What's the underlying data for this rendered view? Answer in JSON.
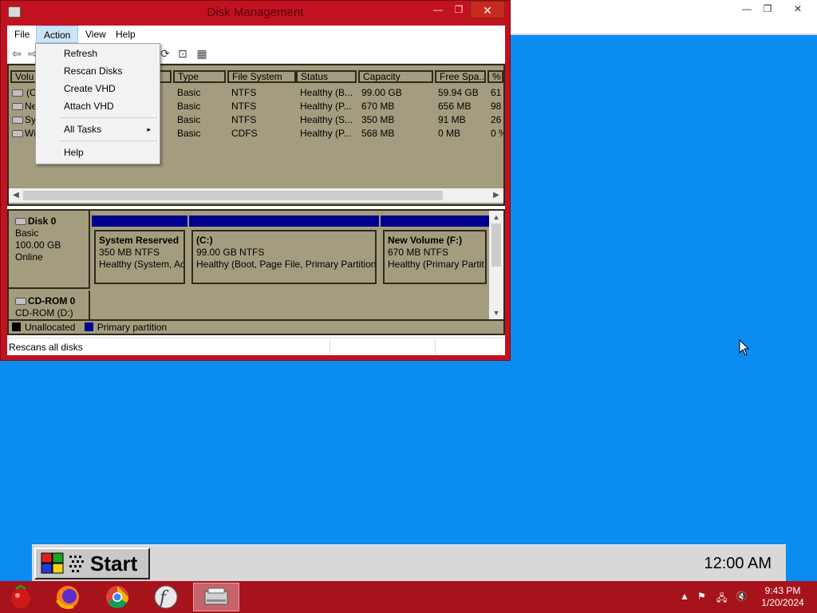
{
  "window": {
    "title": "Disk Management",
    "close_glyph": "✕",
    "min_glyph": "—",
    "max_glyph": "❐"
  },
  "menubar": [
    "File",
    "Action",
    "View",
    "Help"
  ],
  "action_menu": {
    "items": [
      "Refresh",
      "Rescan Disks",
      "Create VHD",
      "Attach VHD",
      "All Tasks",
      "Help"
    ],
    "submenu_arrow": "▸"
  },
  "volume_table": {
    "headers": [
      "Volu",
      "Type",
      "File System",
      "Status",
      "Capacity",
      "Free Spa...",
      "% F"
    ],
    "rows": [
      {
        "name": "(C",
        "type": "Basic",
        "fs": "NTFS",
        "status": "Healthy (B...",
        "capacity": "99.00 GB",
        "free": "59.94 GB",
        "pct": "61"
      },
      {
        "name": "Ne",
        "type": "Basic",
        "fs": "NTFS",
        "status": "Healthy (P...",
        "capacity": "670 MB",
        "free": "656 MB",
        "pct": "98"
      },
      {
        "name": "Sys",
        "type": "Basic",
        "fs": "NTFS",
        "status": "Healthy (S...",
        "capacity": "350 MB",
        "free": "91 MB",
        "pct": "26"
      },
      {
        "name": "Wi",
        "type": "Basic",
        "fs": "CDFS",
        "status": "Healthy (P...",
        "capacity": "568 MB",
        "free": "0 MB",
        "pct": "0 %"
      }
    ]
  },
  "disks": [
    {
      "name": "Disk 0",
      "kind": "Basic",
      "size": "100.00 GB",
      "state": "Online",
      "partitions": [
        {
          "name": "System Reserved",
          "detail": "350 MB NTFS",
          "status": "Healthy (System, Ac"
        },
        {
          "name": "(C:)",
          "detail": "99.00 GB NTFS",
          "status": "Healthy (Boot, Page File, Primary Partition)"
        },
        {
          "name": "New Volume  (F:)",
          "detail": "670 MB NTFS",
          "status": "Healthy (Primary Partit"
        }
      ]
    },
    {
      "name": "CD-ROM 0",
      "kind": "CD-ROM (D:)"
    }
  ],
  "legend": {
    "unallocated": "Unallocated",
    "primary": "Primary partition",
    "colors": {
      "unallocated": "#000000",
      "primary": "#000090"
    }
  },
  "status_text": "Rescans all disks",
  "startbar": {
    "start_label": "Start",
    "clock": "12:00 AM"
  },
  "taskbar": {
    "apps": [
      "tomato-app-icon",
      "firefox-icon",
      "chrome-icon",
      "flash-icon",
      "disk-management-icon"
    ],
    "tray_time": "9:43 PM",
    "tray_date": "1/20/2024"
  },
  "colors": {
    "desktop": "#0a8cf0",
    "window_frame": "#c1121f",
    "panel": "#a49c7e",
    "taskbar": "#a7131b"
  }
}
